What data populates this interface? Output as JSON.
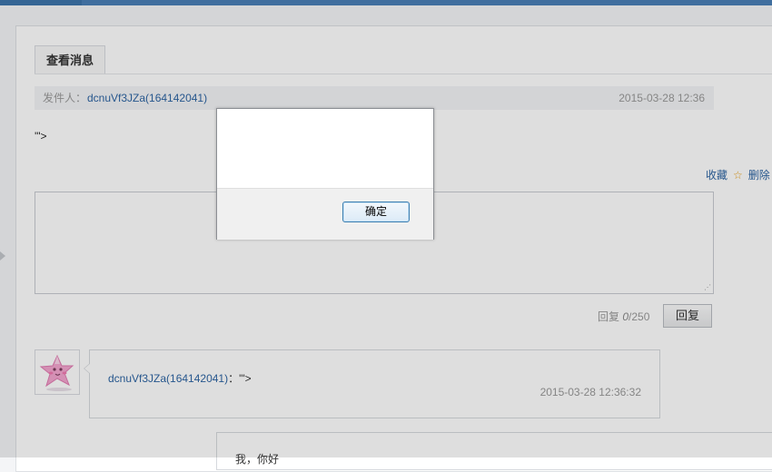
{
  "page": {
    "tab_title": "查看消息",
    "sender_label": "发件人：",
    "sender_name": "dcnuVf3JZa(164142041)",
    "sender_time": "2015-03-28 12:36",
    "message_body": "'\">"
  },
  "actions": {
    "favorite_label": "收藏",
    "star_glyph": "☆",
    "delete_label": "删除"
  },
  "reply": {
    "input_value": "",
    "resize_glyph": "⋰",
    "counter_prefix": "回复 ",
    "counter_current": "0",
    "counter_sep": "/",
    "counter_max": "250",
    "button_label": "回复"
  },
  "thread": {
    "messages": [
      {
        "author": "dcnuVf3JZa(164142041)",
        "separator": "：",
        "text": "'\">",
        "time": "2015-03-28 12:36:32"
      },
      {
        "text": "我，你好"
      }
    ]
  },
  "dialog": {
    "message": "",
    "ok_label": "确定"
  },
  "colors": {
    "link": "#2d64a3",
    "topbar": "#4a7fb6",
    "star": "#e8a21b",
    "dialog_button_border": "#3c7fb1"
  }
}
